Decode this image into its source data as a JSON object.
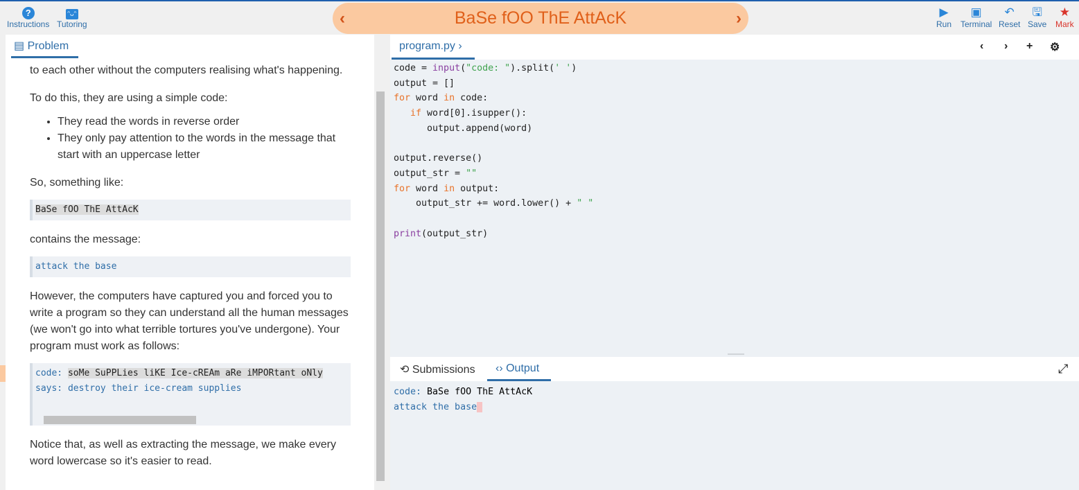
{
  "toolbar": {
    "instructions": "Instructions",
    "tutoring": "Tutoring",
    "run": "Run",
    "terminal": "Terminal",
    "reset": "Reset",
    "save": "Save",
    "mark": "Mark"
  },
  "title": "BaSe fOO ThE AttAcK",
  "problem": {
    "tab": "Problem",
    "p0": "to each other without the computers realising what's happening.",
    "p1": "To do this, they are using a simple code:",
    "bullets": [
      "They read the words in reverse order",
      "They only pay attention to the words in the message that start with an uppercase letter"
    ],
    "p2": "So, something like:",
    "example_in": "BaSe fOO ThE AttAcK",
    "p3": "contains the message:",
    "example_out": "attack the base",
    "p4": "However, the computers have captured you and forced you to write a program so they can understand all the human messages (we won't go into what terrible tortures you've undergone). Your program must work as follows:",
    "demo_code_label": "code: ",
    "demo_code_value": "soMe SuPPLies liKE Ice-cREAm aRe iMPORtant oNly",
    "demo_says": "says: destroy their ice-cream supplies",
    "p5": "Notice that, as well as extracting the message, we make every word lowercase so it's easier to read."
  },
  "editor": {
    "file_tab": "program.py",
    "lines": [
      [
        [
          "code = ",
          ""
        ],
        [
          "input",
          "fn"
        ],
        [
          "(",
          ""
        ],
        [
          "\"code: \"",
          "str"
        ],
        [
          ").split(",
          ""
        ],
        [
          "' '",
          "str"
        ],
        [
          ")",
          ""
        ]
      ],
      [
        [
          "output = []",
          ""
        ]
      ],
      [
        [
          "for",
          "kw"
        ],
        [
          " word ",
          ""
        ],
        [
          "in",
          "kw"
        ],
        [
          " code:",
          ""
        ]
      ],
      [
        [
          "   ",
          ""
        ],
        [
          "if",
          "kw"
        ],
        [
          " word[0].isupper():",
          ""
        ]
      ],
      [
        [
          "      output.append(word)",
          ""
        ]
      ],
      [
        [
          "",
          ""
        ]
      ],
      [
        [
          "output.reverse()",
          ""
        ]
      ],
      [
        [
          "output_str = ",
          ""
        ],
        [
          "\"\"",
          "str"
        ]
      ],
      [
        [
          "for",
          "kw"
        ],
        [
          " word ",
          ""
        ],
        [
          "in",
          "kw"
        ],
        [
          " output:",
          ""
        ]
      ],
      [
        [
          "    output_str += word.lower() + ",
          ""
        ],
        [
          "\" \"",
          "str"
        ]
      ],
      [
        [
          "",
          ""
        ]
      ],
      [
        [
          "print",
          "fn"
        ],
        [
          "(output_str)",
          ""
        ]
      ]
    ]
  },
  "output_panel": {
    "submissions_tab": "Submissions",
    "output_tab": "Output",
    "prompt": "code: ",
    "input": "BaSe fOO ThE AttAcK",
    "result": "attack the base"
  }
}
